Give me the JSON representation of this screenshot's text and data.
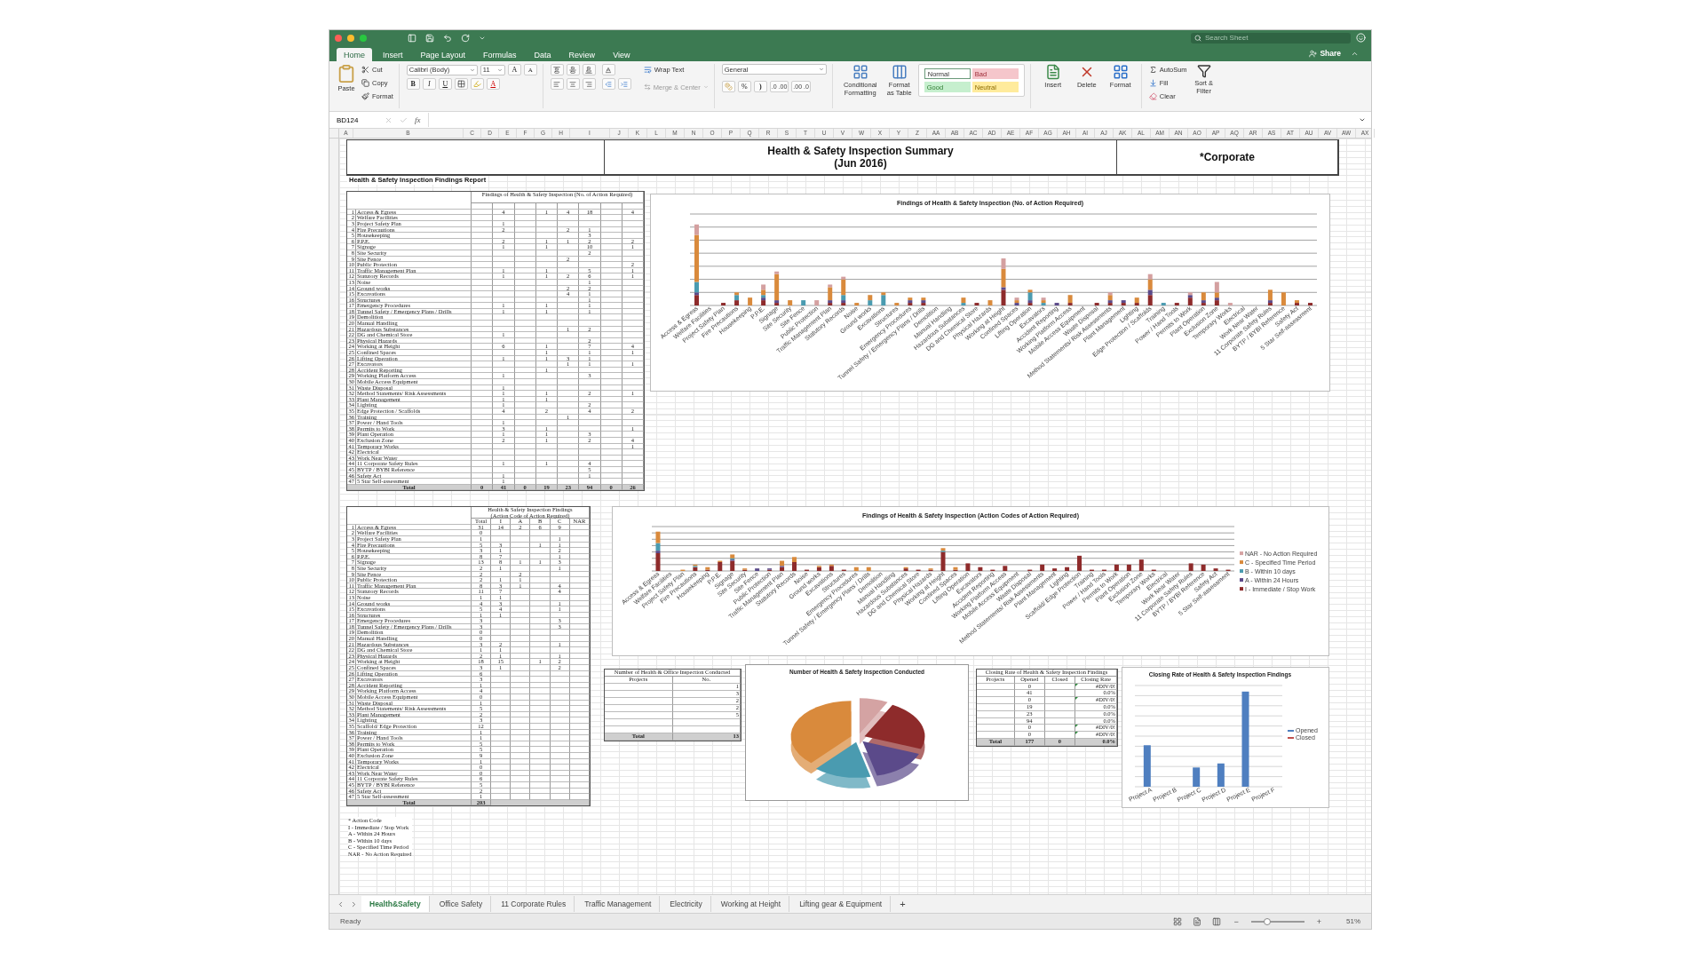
{
  "search": {
    "placeholder": "Search Sheet"
  },
  "menu_tabs": [
    {
      "label": "Home",
      "selected": true
    },
    {
      "label": "Insert",
      "selected": false
    },
    {
      "label": "Page Layout",
      "selected": false
    },
    {
      "label": "Formulas",
      "selected": false
    },
    {
      "label": "Data",
      "selected": false
    },
    {
      "label": "Review",
      "selected": false
    },
    {
      "label": "View",
      "selected": false
    }
  ],
  "share": "Share",
  "ribbon": {
    "clipboard": {
      "paste": "Paste",
      "cut": "Cut",
      "copy": "Copy",
      "format": "Format"
    },
    "font": {
      "name": "Calibri (Body)",
      "size": "11",
      "grow": "A",
      "shrink": "A",
      "bold": "B",
      "italic": "I",
      "underline": "U",
      "font_color": "A"
    },
    "alignment": {
      "wrap": "Wrap Text",
      "merge": "Merge & Center"
    },
    "number": {
      "format": "General",
      "percent": "%",
      "comma": ")",
      "increase_decimal": [
        ".0",
        ".00"
      ],
      "decrease_decimal": [
        ".00",
        ".0"
      ]
    },
    "styles": {
      "conditional": "Conditional Formatting",
      "format_table": "Format as Table",
      "gallery": [
        {
          "label": "Normal",
          "kind": "normal"
        },
        {
          "label": "Bad",
          "kind": "bad"
        },
        {
          "label": "Good",
          "kind": "good"
        },
        {
          "label": "Neutral",
          "kind": "neutral"
        }
      ]
    },
    "cells": [
      {
        "label": "Insert",
        "kind": "insert"
      },
      {
        "label": "Delete",
        "kind": "delete"
      },
      {
        "label": "Format",
        "kind": "format"
      }
    ],
    "editing": {
      "autosum": "AutoSum",
      "fill": "Fill",
      "clear": "Clear",
      "sort": "Sort & Filter"
    }
  },
  "formula_bar": {
    "cell": "BD124",
    "fx": "fx"
  },
  "columns": [
    "A",
    "B",
    "C",
    "D",
    "E",
    "F",
    "G",
    "H",
    "I",
    "J",
    "K",
    "L",
    "M",
    "N",
    "O",
    "P",
    "Q",
    "R",
    "S",
    "T",
    "U",
    "V",
    "W",
    "X",
    "Y",
    "Z",
    "AA",
    "AB",
    "AC",
    "AD",
    "AE",
    "AF",
    "AG",
    "AH",
    "AI",
    "AJ",
    "AK",
    "AL",
    "AM",
    "AN",
    "AO",
    "AP",
    "AQ",
    "AR",
    "AS",
    "AT",
    "AU",
    "AV",
    "AW",
    "AX"
  ],
  "sheet": {
    "title_lines": [
      "Health & Safety Inspection Summary",
      "(Jun 2016)"
    ],
    "scope": "*Corporate",
    "report_heading": "Health & Safety Inspection Findings Report",
    "findings_table": {
      "header": "Findings of Health & Safety Inspection (No. of Action Required)",
      "total_label": "Total",
      "totals": [
        "0",
        "41",
        "0",
        "19",
        "23",
        "94",
        "0",
        "26"
      ],
      "rows": [
        {
          "no": "1",
          "item": "Access & Egress",
          "counts": {
            "c2": "4",
            "c4": "1",
            "c5": "4",
            "c6": "18",
            "c8": "4"
          }
        },
        {
          "no": "2",
          "item": "Welfare Facilities",
          "counts": {}
        },
        {
          "no": "3",
          "item": "Project Safety Plan",
          "counts": {
            "c2": "1"
          }
        },
        {
          "no": "4",
          "item": "Fire Precautions",
          "counts": {
            "c2": "2",
            "c5": "2",
            "c6": "1"
          }
        },
        {
          "no": "5",
          "item": "Housekeeping",
          "counts": {
            "c6": "3"
          }
        },
        {
          "no": "6",
          "item": "P.P.E.",
          "counts": {
            "c2": "2",
            "c4": "1",
            "c5": "1",
            "c6": "2",
            "c8": "2"
          }
        },
        {
          "no": "7",
          "item": "Signage",
          "counts": {
            "c2": "1",
            "c4": "1",
            "c6": "10",
            "c8": "1"
          }
        },
        {
          "no": "8",
          "item": "Site Security",
          "counts": {
            "c6": "2"
          }
        },
        {
          "no": "9",
          "item": "Site Fence",
          "counts": {
            "c5": "2"
          }
        },
        {
          "no": "10",
          "item": "Public Protection",
          "counts": {
            "c8": "2"
          }
        },
        {
          "no": "11",
          "item": "Traffic Management Plan",
          "counts": {
            "c2": "1",
            "c4": "1",
            "c6": "5",
            "c8": "1"
          }
        },
        {
          "no": "12",
          "item": "Statutory Records",
          "counts": {
            "c2": "1",
            "c4": "1",
            "c5": "2",
            "c6": "6",
            "c8": "1"
          }
        },
        {
          "no": "13",
          "item": "Noise",
          "counts": {
            "c6": "1"
          }
        },
        {
          "no": "14",
          "item": "Ground works",
          "counts": {
            "c5": "2",
            "c6": "2"
          }
        },
        {
          "no": "15",
          "item": "Excavations",
          "counts": {
            "c5": "4",
            "c6": "1"
          }
        },
        {
          "no": "16",
          "item": "Structures",
          "counts": {
            "c6": "1"
          }
        },
        {
          "no": "17",
          "item": "Emergency Procedures",
          "counts": {
            "c2": "1",
            "c4": "1",
            "c6": "1"
          }
        },
        {
          "no": "18",
          "item": "Tunnel Safety / Emergency Plans / Drills",
          "counts": {
            "c2": "1",
            "c4": "1",
            "c6": "1"
          }
        },
        {
          "no": "19",
          "item": "Demolition",
          "counts": {}
        },
        {
          "no": "20",
          "item": "Manual Handling",
          "counts": {}
        },
        {
          "no": "21",
          "item": "Hazardous Substances",
          "counts": {
            "c5": "1",
            "c6": "2"
          }
        },
        {
          "no": "22",
          "item": "DG and Chemical Store",
          "counts": {
            "c2": "1"
          }
        },
        {
          "no": "23",
          "item": "Physical Hazards",
          "counts": {
            "c6": "2"
          }
        },
        {
          "no": "24",
          "item": "Working at Height",
          "counts": {
            "c2": "6",
            "c4": "1",
            "c6": "7",
            "c8": "4"
          }
        },
        {
          "no": "25",
          "item": "Confined Spaces",
          "counts": {
            "c4": "1",
            "c6": "1",
            "c8": "1"
          }
        },
        {
          "no": "26",
          "item": "Lifting Operation",
          "counts": {
            "c2": "1",
            "c4": "1",
            "c5": "3",
            "c6": "1"
          }
        },
        {
          "no": "27",
          "item": "Excavators",
          "counts": {
            "c5": "1",
            "c6": "1",
            "c8": "1"
          }
        },
        {
          "no": "28",
          "item": "Accident Reporting",
          "counts": {
            "c4": "1"
          }
        },
        {
          "no": "29",
          "item": "Working Platform Access",
          "counts": {
            "c2": "1",
            "c6": "3"
          }
        },
        {
          "no": "30",
          "item": "Mobile Access Equipment",
          "counts": {}
        },
        {
          "no": "31",
          "item": "Waste Disposal",
          "counts": {
            "c2": "1"
          }
        },
        {
          "no": "32",
          "item": "Method Statements/ Risk Assessments",
          "counts": {
            "c2": "1",
            "c4": "1",
            "c6": "2",
            "c8": "1"
          }
        },
        {
          "no": "33",
          "item": "Plant Management",
          "counts": {
            "c2": "1",
            "c4": "1"
          }
        },
        {
          "no": "34",
          "item": "Lighting",
          "counts": {
            "c2": "1",
            "c6": "2"
          }
        },
        {
          "no": "35",
          "item": "Edge Protection / Scaffolds",
          "counts": {
            "c2": "4",
            "c4": "2",
            "c6": "4",
            "c8": "2"
          }
        },
        {
          "no": "36",
          "item": "Training",
          "counts": {
            "c5": "1"
          }
        },
        {
          "no": "37",
          "item": "Power / Hand Tools",
          "counts": {
            "c2": "1"
          }
        },
        {
          "no": "38",
          "item": "Permits to Work",
          "counts": {
            "c2": "3",
            "c4": "1",
            "c8": "1"
          }
        },
        {
          "no": "39",
          "item": "Plant Operation",
          "counts": {
            "c2": "1",
            "c4": "1",
            "c6": "3"
          }
        },
        {
          "no": "40",
          "item": "Exclusion Zone",
          "counts": {
            "c2": "2",
            "c4": "1",
            "c6": "2",
            "c8": "4"
          }
        },
        {
          "no": "41",
          "item": "Temporary Works",
          "counts": {
            "c8": "1"
          }
        },
        {
          "no": "42",
          "item": "Electrical",
          "counts": {}
        },
        {
          "no": "43",
          "item": "Work Near Water",
          "counts": {}
        },
        {
          "no": "44",
          "item": "11 Corporate Safety Rules",
          "counts": {
            "c2": "1",
            "c4": "1",
            "c6": "4"
          }
        },
        {
          "no": "45",
          "item": "BYTP / BYBI Reference",
          "counts": {
            "c6": "5"
          }
        },
        {
          "no": "46",
          "item": "Safety Act",
          "counts": {
            "c2": "1",
            "c6": "1"
          }
        },
        {
          "no": "47",
          "item": "5 Star Self-assessment",
          "counts": {
            "c2": "1"
          }
        }
      ]
    },
    "findings_chart": {
      "title": "Findings of Health & Safety Inspection  (No. of Action Required)",
      "labels": [
        "Access & Egress",
        "Welfare Facilities",
        "Project Safety Plan",
        "Fire Precautions",
        "Housekeeping",
        "P.P.E.",
        "Signage",
        "Site Security",
        "Site Fence",
        "Public Protection",
        "Traffic Management Plan",
        "Statutory Records",
        "Noise",
        "Ground works",
        "Excavations",
        "Structures",
        "Emergency Procedures",
        "Tunnel Safety / Emergency Plans / Drills",
        "Demolition",
        "Manual Handling",
        "Hazardous Substances",
        "DG and Chemical Store",
        "Physical Hazards",
        "Working at Height",
        "Confined Spaces",
        "Lifting Operation",
        "Excavators",
        "Accident Reporting",
        "Working Platform Access",
        "Mobile Access Equipment",
        "Waste Disposal",
        "Method Statements/ Risk Assessments",
        "Plant Management",
        "Lighting",
        "Edge Protection / Scaffolds",
        "Training",
        "Power / Hand Tools",
        "Permits to Work",
        "Plant Operation",
        "Exclusion Zone",
        "Temporary Works",
        "Electrical",
        "Work Near Water",
        "11 Corporate Safety Rules",
        "BYTP / BYBI Reference",
        "Safety Act",
        "5 Star Self-assessment"
      ]
    },
    "code_table": {
      "header_lines": [
        "Health & Safety Inspection Findings",
        "(Action Code of Action Required)"
      ],
      "columns": [
        "Total",
        "I",
        "A",
        "B",
        "C",
        "NAR"
      ],
      "total_label": "Total",
      "grand_total": "203",
      "rows": [
        {
          "no": "1",
          "item": "Access & Egress",
          "total": "31",
          "i": "14",
          "a": "2",
          "b": "6",
          "c": "9"
        },
        {
          "no": "2",
          "item": "Welfare Facilities",
          "total": "0"
        },
        {
          "no": "3",
          "item": "Project Safety Plan",
          "total": "1",
          "c": "1"
        },
        {
          "no": "4",
          "item": "Fire Precautions",
          "total": "5",
          "i": "3",
          "b": "1",
          "c": "1"
        },
        {
          "no": "5",
          "item": "Housekeeping",
          "total": "3",
          "i": "1",
          "c": "2"
        },
        {
          "no": "6",
          "item": "P.P.E.",
          "total": "8",
          "i": "7",
          "c": "1"
        },
        {
          "no": "7",
          "item": "Signage",
          "total": "13",
          "i": "8",
          "a": "1",
          "b": "1",
          "c": "3"
        },
        {
          "no": "8",
          "item": "Site Security",
          "total": "2",
          "i": "1",
          "c": "1"
        },
        {
          "no": "9",
          "item": "Site Fence",
          "total": "2",
          "a": "2"
        },
        {
          "no": "10",
          "item": "Public Protection",
          "total": "2",
          "i": "1",
          "a": "1"
        },
        {
          "no": "11",
          "item": "Traffic Management Plan",
          "total": "8",
          "i": "3",
          "a": "1",
          "c": "4"
        },
        {
          "no": "12",
          "item": "Statutory Records",
          "total": "11",
          "i": "7",
          "c": "4"
        },
        {
          "no": "13",
          "item": "Noise",
          "total": "1",
          "i": "1"
        },
        {
          "no": "14",
          "item": "Ground works",
          "total": "4",
          "i": "3",
          "c": "1"
        },
        {
          "no": "15",
          "item": "Excavations",
          "total": "5",
          "i": "4",
          "c": "1"
        },
        {
          "no": "16",
          "item": "Structures",
          "total": "1",
          "i": "1"
        },
        {
          "no": "17",
          "item": "Emergency Procedures",
          "total": "3",
          "c": "3"
        },
        {
          "no": "18",
          "item": "Tunnel Safety / Emergency Plans / Drills",
          "total": "3",
          "c": "3"
        },
        {
          "no": "19",
          "item": "Demolition",
          "total": "0"
        },
        {
          "no": "20",
          "item": "Manual Handling",
          "total": "0"
        },
        {
          "no": "21",
          "item": "Hazardous Substances",
          "total": "3",
          "i": "2",
          "c": "1"
        },
        {
          "no": "22",
          "item": "DG and Chemical Store",
          "total": "1",
          "i": "1"
        },
        {
          "no": "23",
          "item": "Physical Hazards",
          "total": "2",
          "i": "1",
          "c": "1"
        },
        {
          "no": "24",
          "item": "Working at Height",
          "total": "18",
          "i": "15",
          "b": "1",
          "c": "2"
        },
        {
          "no": "25",
          "item": "Confined Spaces",
          "total": "3",
          "i": "1",
          "c": "2"
        },
        {
          "no": "26",
          "item": "Lifting Operation",
          "total": "6"
        },
        {
          "no": "27",
          "item": "Excavators",
          "total": "3"
        },
        {
          "no": "28",
          "item": "Accident Reporting",
          "total": "1"
        },
        {
          "no": "29",
          "item": "Working Platform Access",
          "total": "4"
        },
        {
          "no": "30",
          "item": "Mobile Access Equipment",
          "total": "0"
        },
        {
          "no": "31",
          "item": "Waste Disposal",
          "total": "1"
        },
        {
          "no": "32",
          "item": "Method Statements/ Risk Assessments",
          "total": "5"
        },
        {
          "no": "33",
          "item": "Plant Management",
          "total": "2"
        },
        {
          "no": "34",
          "item": "Lighting",
          "total": "3"
        },
        {
          "no": "35",
          "item": "Scaffold/ Edge Protection",
          "total": "12"
        },
        {
          "no": "36",
          "item": "Training",
          "total": "1"
        },
        {
          "no": "37",
          "item": "Power / Hand Tools",
          "total": "1"
        },
        {
          "no": "38",
          "item": "Permits to Work",
          "total": "5"
        },
        {
          "no": "39",
          "item": "Plant Operation",
          "total": "5"
        },
        {
          "no": "40",
          "item": "Exclusion Zone",
          "total": "9"
        },
        {
          "no": "41",
          "item": "Temporary Works",
          "total": "1"
        },
        {
          "no": "42",
          "item": "Electrical",
          "total": "0"
        },
        {
          "no": "43",
          "item": "Work Near Water",
          "total": "0"
        },
        {
          "no": "44",
          "item": "11 Corporate Safety Rules",
          "total": "6"
        },
        {
          "no": "45",
          "item": "BYTP / BYBI Reference",
          "total": "5"
        },
        {
          "no": "46",
          "item": "Safety Act",
          "total": "2"
        },
        {
          "no": "47",
          "item": "5 Star Self-assessment",
          "total": "1"
        }
      ]
    },
    "code_chart": {
      "title": "Findings of Health & Safety Inspection (Action Codes of Action Required)",
      "labels": [
        "Access & Egress",
        "Welfare Facilities",
        "Project Safety Plan",
        "Fire Precautions",
        "Housekeeping",
        "P.P.E.",
        "Signage",
        "Site Security",
        "Site Fence",
        "Public Protection",
        "Traffic Management Plan",
        "Statutory Records",
        "Noise",
        "Ground works",
        "Excavations",
        "Structures",
        "Emergency Procedures",
        "Tunnel Safety / Emergency Plans / Drills",
        "Demolition",
        "Manual Handling",
        "Hazardous Substances",
        "DG and Chemical Store",
        "Physical Hazards",
        "Working at Height",
        "Confined Spaces",
        "Lifting Operation",
        "Excavators",
        "Accident Reporting",
        "Working Platform Access",
        "Mobile Access Equipment",
        "Waste Disposal",
        "Method Statements/ Risk Assessments",
        "Plant Management",
        "Lighting",
        "Scaffold/ Edge Protection",
        "Training",
        "Power / Hand Tools",
        "Permits to Work",
        "Plant Operation",
        "Exclusion Zone",
        "Temporary Works",
        "Electrical",
        "Work Near Water",
        "11 Corporate Safety Rules",
        "BYTP / BYBI Reference",
        "Safety Act",
        "5 Star Self-assessment"
      ],
      "legend": [
        {
          "label": "NAR - No Action Required",
          "color": "#d6a3a3"
        },
        {
          "label": "C - Specified Time Period",
          "color": "#d98a3c"
        },
        {
          "label": "B - Within 10 days",
          "color": "#4a9bb0"
        },
        {
          "label": "A - Within 24 Hours",
          "color": "#5b4a8a"
        },
        {
          "label": "I - Immediate / Stop Work",
          "color": "#8e2b2b"
        }
      ]
    },
    "inspections_table": {
      "header": "Number of Health & Office Inspection Conducted",
      "columns": [
        "Projects",
        "No."
      ],
      "rows": [
        "1",
        "3",
        "2",
        "2",
        "5"
      ],
      "total_label": "Total",
      "total": "13"
    },
    "pie": {
      "title": "Number of Health & Safety Inspection Conducted",
      "slices": [
        {
          "color": "#d4a3a3"
        },
        {
          "color": "#8e2b2b"
        },
        {
          "color": "#5b4a8a"
        },
        {
          "color": "#4a9bb0"
        },
        {
          "color": "#d98a3c"
        }
      ]
    },
    "closing_table": {
      "header": "Closing Rate of Health & Safety Inspection Findings",
      "columns": [
        "Projects",
        "Opened",
        "Closed",
        "Closing Rate"
      ],
      "rows": [
        {
          "opened": "0",
          "rate": "#DIV/0!",
          "flagged": true
        },
        {
          "opened": "41",
          "rate": "0.0%",
          "flagged": false
        },
        {
          "opened": "0",
          "rate": "#DIV/0!",
          "flagged": true
        },
        {
          "opened": "19",
          "rate": "0.0%",
          "flagged": false
        },
        {
          "opened": "23",
          "rate": "0.0%",
          "flagged": false
        },
        {
          "opened": "94",
          "rate": "0.0%",
          "flagged": false
        },
        {
          "opened": "0",
          "rate": "#DIV/0!",
          "flagged": true
        },
        {
          "opened": "0",
          "rate": "#DIV/0!",
          "flagged": true
        }
      ],
      "total_label": "Total",
      "total_opened": "177",
      "total_closed": "0",
      "total_rate": "0.0%"
    },
    "closing_chart": {
      "title": "Closing Rate of Health & Safety Inspection Findings",
      "x_labels": [
        "Project A",
        "Project B",
        "Project C",
        "Project D",
        "Project E",
        "Project F"
      ],
      "legend": [
        {
          "label": "Opened",
          "color": "#4f7fc0"
        },
        {
          "label": "Closed",
          "color": "#c0504d"
        }
      ]
    },
    "notes": [
      "* Action Code",
      "I - Immediate / Stop Work",
      "A - Within 24 Hours",
      "B - Within 10 days",
      "C - Specified Time Period",
      "NAR - No Action Required"
    ]
  },
  "sheet_tabs": [
    {
      "label": "Health&Safety",
      "selected": true
    },
    {
      "label": "Office Safety",
      "selected": false
    },
    {
      "label": "11 Corporate Rules",
      "selected": false
    },
    {
      "label": "Traffic Management",
      "selected": false
    },
    {
      "label": "Electricity",
      "selected": false
    },
    {
      "label": "Working at Height",
      "selected": false
    },
    {
      "label": "Lifting gear & Equipment",
      "selected": false
    }
  ],
  "add_sheet": "+",
  "status": {
    "text": "Ready",
    "zoom_minus": "−",
    "zoom_plus": "+",
    "zoom": {
      "level": 0.3,
      "reading": "51%"
    }
  }
}
